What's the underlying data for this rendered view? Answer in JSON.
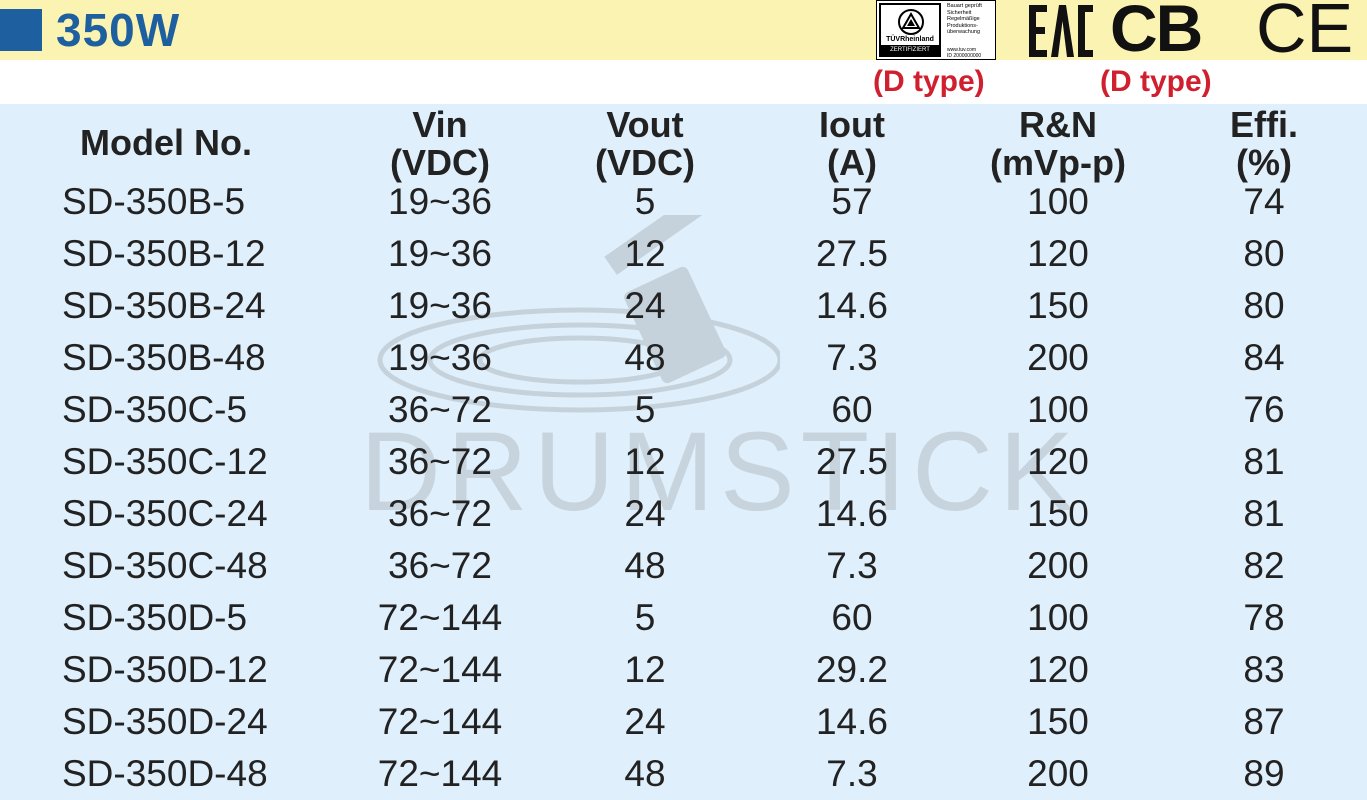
{
  "header": {
    "title": "350W",
    "tuv": {
      "brand": "TÜVRheinland",
      "zert": "ZERTIFIZIERT",
      "lines": [
        "Bauart geprüft",
        "Sicherheit",
        "Regelmäßige",
        "Produktions-",
        "überwachung"
      ],
      "url": "www.tuv.com",
      "id": "ID 2000000000"
    },
    "eac_label": "EAC",
    "cb_label": "CB",
    "ce_label": "CE",
    "tuv_note": "(D type)",
    "cb_note": "(D type)",
    "colors": {
      "header_bg": "#fbf3b2",
      "accent": "#1e5fa0",
      "note": "#d0202f",
      "table_bg": "#dfeffb"
    }
  },
  "watermark": {
    "text": "DRUMSTICK"
  },
  "table": {
    "headers": [
      [
        "Model No.",
        ""
      ],
      [
        "Vin",
        "(VDC)"
      ],
      [
        "Vout",
        "(VDC)"
      ],
      [
        "Iout",
        "(A)"
      ],
      [
        "R&N",
        "(mVp-p)"
      ],
      [
        "Effi.",
        "(%)"
      ]
    ],
    "rows": [
      [
        "SD-350B-5",
        "19~36",
        "5",
        "57",
        "100",
        "74"
      ],
      [
        "SD-350B-12",
        "19~36",
        "12",
        "27.5",
        "120",
        "80"
      ],
      [
        "SD-350B-24",
        "19~36",
        "24",
        "14.6",
        "150",
        "80"
      ],
      [
        "SD-350B-48",
        "19~36",
        "48",
        "7.3",
        "200",
        "84"
      ],
      [
        "SD-350C-5",
        "36~72",
        "5",
        "60",
        "100",
        "76"
      ],
      [
        "SD-350C-12",
        "36~72",
        "12",
        "27.5",
        "120",
        "81"
      ],
      [
        "SD-350C-24",
        "36~72",
        "24",
        "14.6",
        "150",
        "81"
      ],
      [
        "SD-350C-48",
        "36~72",
        "48",
        "7.3",
        "200",
        "82"
      ],
      [
        "SD-350D-5",
        "72~144",
        "5",
        "60",
        "100",
        "78"
      ],
      [
        "SD-350D-12",
        "72~144",
        "12",
        "29.2",
        "120",
        "83"
      ],
      [
        "SD-350D-24",
        "72~144",
        "24",
        "14.6",
        "150",
        "87"
      ],
      [
        "SD-350D-48",
        "72~144",
        "48",
        "7.3",
        "200",
        "89"
      ]
    ]
  }
}
